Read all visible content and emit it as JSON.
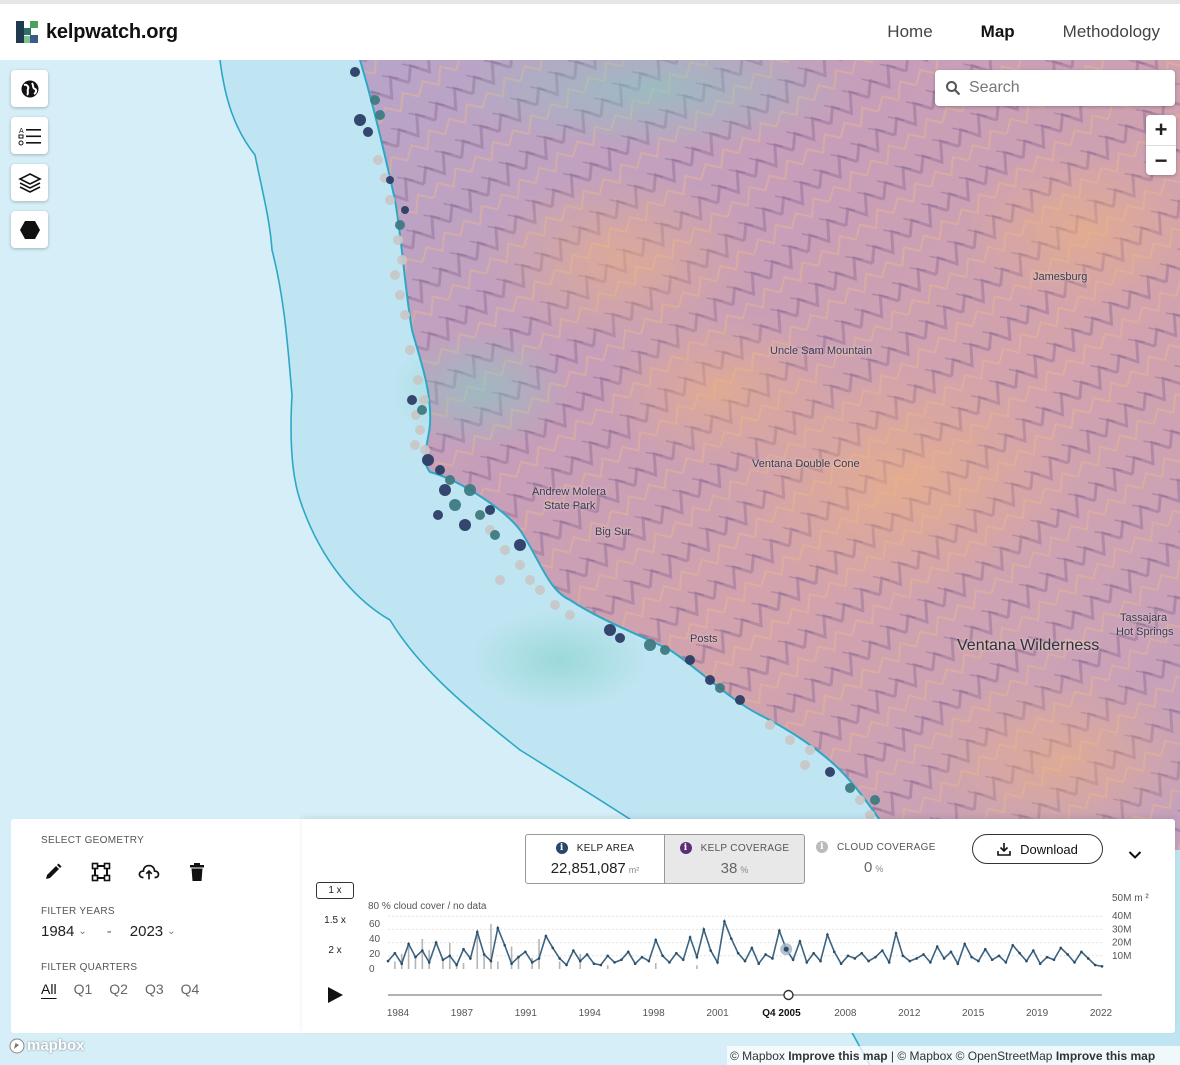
{
  "header": {
    "logo_text": "kelpwatch.org",
    "nav": [
      {
        "label": "Home",
        "active": false
      },
      {
        "label": "Map",
        "active": true
      },
      {
        "label": "Methodology",
        "active": false
      }
    ]
  },
  "map": {
    "search_placeholder": "Search",
    "zoom_in": "+",
    "zoom_out": "−",
    "places": {
      "jamesburg": "Jamesburg",
      "uncle_sam": "Uncle Sam Mountain",
      "ventana_cone": "Ventana Double Cone",
      "andrew_molera_1": "Andrew Molera",
      "andrew_molera_2": "State Park",
      "big_sur": "Big Sur",
      "posts": "Posts",
      "tassajara_1": "Tassajara",
      "tassajara_2": "Hot Springs",
      "ventana_wilderness": "Ventana Wilderness"
    },
    "controls": [
      "globe-icon",
      "legend-icon",
      "layers-icon",
      "hexagon-icon"
    ]
  },
  "left_panel": {
    "select_geometry_label": "SELECT GEOMETRY",
    "filter_years_label": "FILTER YEARS",
    "year_from": "1984",
    "year_separator": "-",
    "year_to": "2023",
    "filter_quarters_label": "FILTER QUARTERS",
    "quarters": [
      {
        "label": "All",
        "active": true
      },
      {
        "label": "Q1",
        "active": false
      },
      {
        "label": "Q2",
        "active": false
      },
      {
        "label": "Q3",
        "active": false
      },
      {
        "label": "Q4",
        "active": false
      }
    ]
  },
  "stats": {
    "kelp_area_label": "KELP AREA",
    "kelp_area_value": "22,851,087",
    "kelp_area_unit": "m²",
    "kelp_coverage_label": "KELP COVERAGE",
    "kelp_coverage_value": "38",
    "kelp_coverage_unit": "%",
    "cloud_coverage_label": "CLOUD COVERAGE",
    "cloud_coverage_value": "0",
    "cloud_coverage_unit": "%",
    "download_label": "Download"
  },
  "playback": {
    "speeds": [
      {
        "label": "1 x",
        "active": true
      },
      {
        "label": "1.5 x",
        "active": false
      },
      {
        "label": "2 x",
        "active": false
      }
    ]
  },
  "chart_data": {
    "type": "line",
    "left_axis_title": "80 % cloud cover / no data",
    "left_ticks": [
      "60",
      "40",
      "20",
      "0"
    ],
    "right_axis_title": "50M m ²",
    "right_ticks": [
      "40M",
      "30M",
      "20M",
      "10M"
    ],
    "x_labels": [
      "1984",
      "1987",
      "1991",
      "1994",
      "1998",
      "2001",
      "Q4 2005",
      "2008",
      "2012",
      "2015",
      "2019",
      "2022"
    ],
    "selected_label": "Q4 2005",
    "x_range": [
      1984,
      2023
    ],
    "kelp_area_millions_m2": [
      6,
      12,
      4,
      19,
      9,
      14,
      5,
      20,
      7,
      10,
      3,
      15,
      8,
      28,
      11,
      6,
      31,
      18,
      4,
      9,
      13,
      5,
      8,
      25,
      16,
      8,
      3,
      14,
      6,
      11,
      4,
      3,
      10,
      5,
      7,
      13,
      4,
      9,
      6,
      22,
      10,
      5,
      12,
      7,
      24,
      9,
      30,
      14,
      5,
      36,
      23,
      12,
      6,
      16,
      4,
      11,
      8,
      29,
      15,
      7,
      21,
      5,
      12,
      6,
      26,
      13,
      4,
      10,
      8,
      12,
      6,
      9,
      14,
      5,
      27,
      10,
      6,
      8,
      11,
      5,
      17,
      8,
      13,
      4,
      19,
      9,
      6,
      15,
      7,
      10,
      5,
      18,
      12,
      6,
      14,
      4,
      9,
      7,
      16,
      11,
      5,
      13,
      8,
      3,
      2
    ],
    "cloud_cover_pct": [
      0,
      10,
      20,
      30,
      15,
      40,
      25,
      0,
      12,
      35,
      5,
      8,
      0,
      45,
      20,
      60,
      10,
      0,
      30,
      18,
      0,
      15,
      40,
      0,
      0,
      10,
      0,
      0,
      20,
      0,
      0,
      0,
      5,
      0,
      0,
      0,
      0,
      0,
      0,
      8,
      0,
      0,
      0,
      0,
      0,
      5,
      0,
      0,
      0,
      0,
      0,
      0,
      0,
      0,
      0,
      0,
      0,
      0,
      0,
      0,
      0,
      0,
      0,
      0,
      0,
      0,
      0,
      0,
      0,
      0,
      0,
      0,
      0,
      0,
      0,
      0,
      0,
      0,
      0,
      0,
      0,
      0,
      0,
      0,
      0,
      0,
      0,
      0,
      0,
      0,
      0,
      0,
      0,
      0,
      0,
      0,
      0,
      0,
      0,
      0,
      0,
      0,
      0,
      0,
      0
    ]
  }
}
